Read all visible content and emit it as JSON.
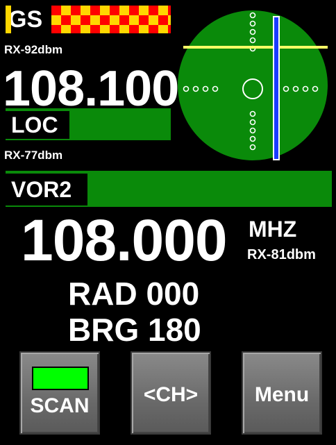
{
  "glideslope": {
    "label": "GS",
    "rx": "RX-92dbm",
    "flag_colors": [
      "#ff0000",
      "#ffd700"
    ]
  },
  "nav": {
    "frequency": "108.100",
    "loc_label": "LOC",
    "loc_rx": "RX-77dbm"
  },
  "vor": {
    "label": "VOR2",
    "frequency": "108.000",
    "unit": "MHZ",
    "rx": "RX-81dbm",
    "radial": "RAD 000",
    "bearing": "BRG 180"
  },
  "buttons": {
    "scan": "SCAN",
    "channel": "<CH>",
    "menu": "Menu"
  },
  "indicator": {
    "scope_color": "#0a8a0a",
    "horizontal_needle_color": "#ffff66",
    "vertical_needle_color": "#1a3cff",
    "scan_active_color": "#00ff00"
  }
}
